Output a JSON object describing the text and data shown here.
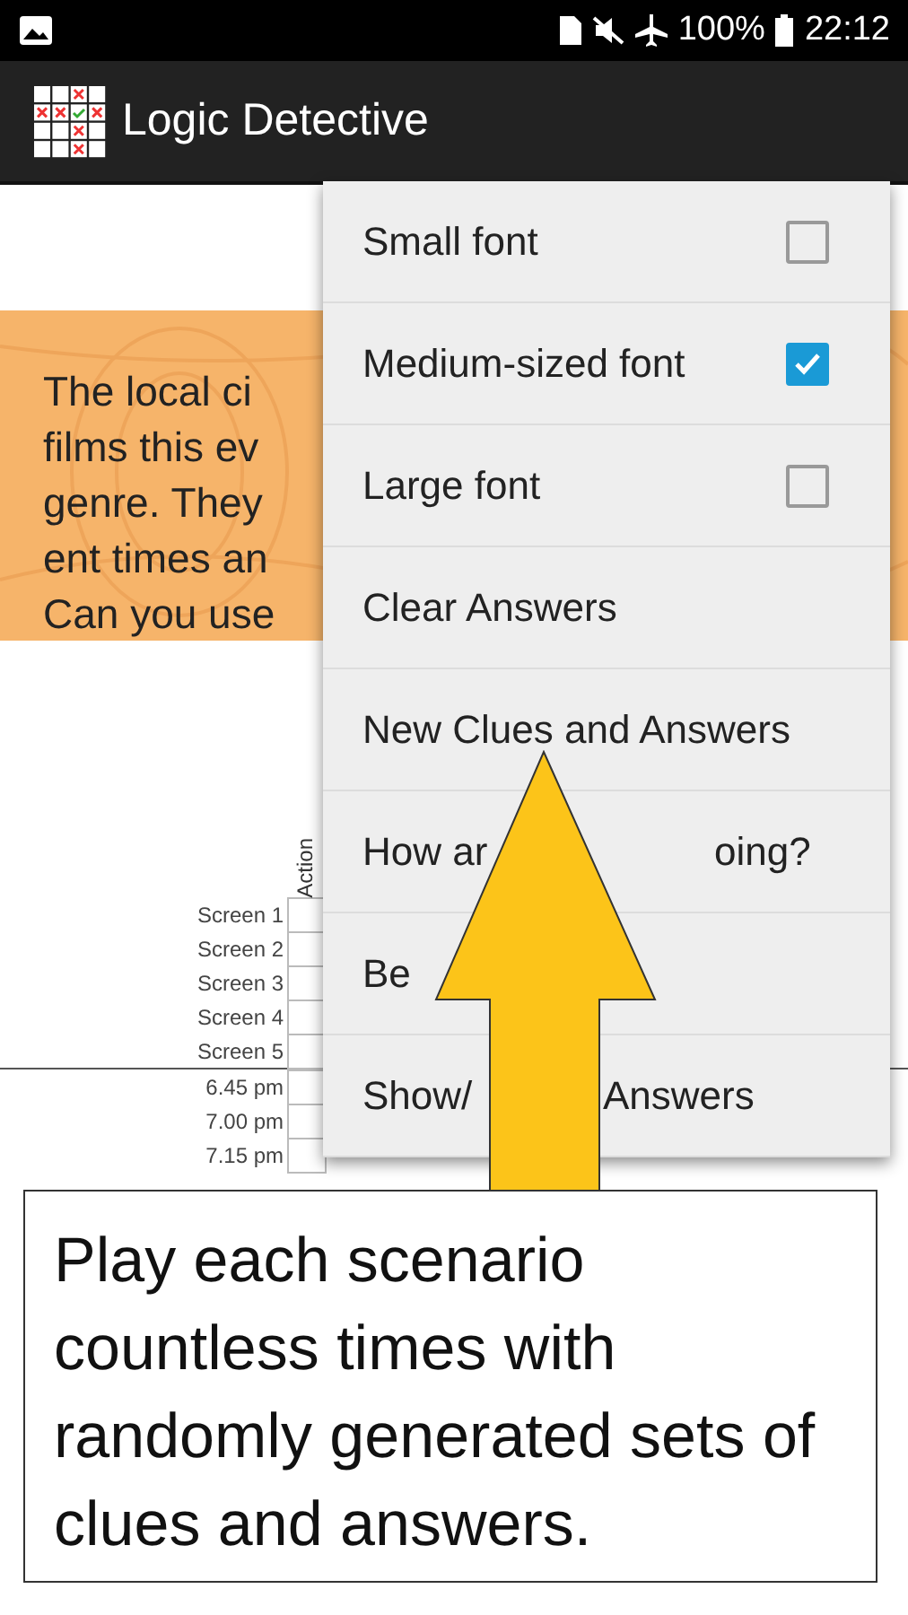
{
  "status_bar": {
    "battery": "100%",
    "time": "22:12"
  },
  "app_bar": {
    "title": "Logic Detective"
  },
  "intro_lines": [
    "The local ci",
    "films this ev",
    "genre. They",
    "ent times an",
    "Can you use"
  ],
  "grid": {
    "column_header": "Action",
    "screen_rows": [
      "Screen 1",
      "Screen 2",
      "Screen 3",
      "Screen 4",
      "Screen 5"
    ],
    "time_rows": [
      "6.45 pm",
      "7.00 pm",
      "7.15 pm"
    ]
  },
  "menu": [
    {
      "kind": "checkbox",
      "label": "Small font",
      "checked": false
    },
    {
      "kind": "checkbox",
      "label": "Medium-sized font",
      "checked": true
    },
    {
      "kind": "checkbox",
      "label": "Large font",
      "checked": false
    },
    {
      "kind": "action",
      "label": "Clear Answers"
    },
    {
      "kind": "action",
      "label": "New Clues and Answers"
    },
    {
      "kind": "action",
      "label": "How ar",
      "label_end": "oing?"
    },
    {
      "kind": "action",
      "label": "Be"
    },
    {
      "kind": "action",
      "label": "Show/",
      "label_end": "Answers"
    }
  ],
  "caption": "Play each scenario countless times with randomly generated sets of clues and answers."
}
